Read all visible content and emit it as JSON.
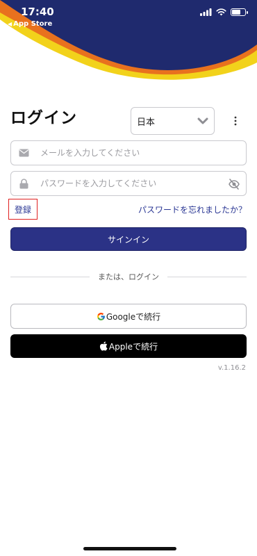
{
  "status_bar": {
    "time": "17:40",
    "back_app": "App Store",
    "icons": [
      "signal-icon",
      "wifi-icon",
      "battery-icon"
    ]
  },
  "header": {
    "colors": {
      "navy": "#1f2a6e",
      "yellow": "#f2d21b",
      "orange": "#e8711e"
    }
  },
  "login": {
    "title": "ログイン",
    "language": "日本",
    "email_placeholder": "メールを入力してください",
    "password_placeholder": "パスワードを入力してください",
    "register_label": "登録",
    "forgot_label": "パスワードを忘れましたか？",
    "signin_label": "サインイン",
    "divider_label": "または、ログイン",
    "google_label": "Googleで続行",
    "apple_label": "Appleで続行",
    "version": "v.1.16.2"
  },
  "colors": {
    "primary": "#2b3286",
    "link": "#283593",
    "highlight": "#e02020"
  }
}
